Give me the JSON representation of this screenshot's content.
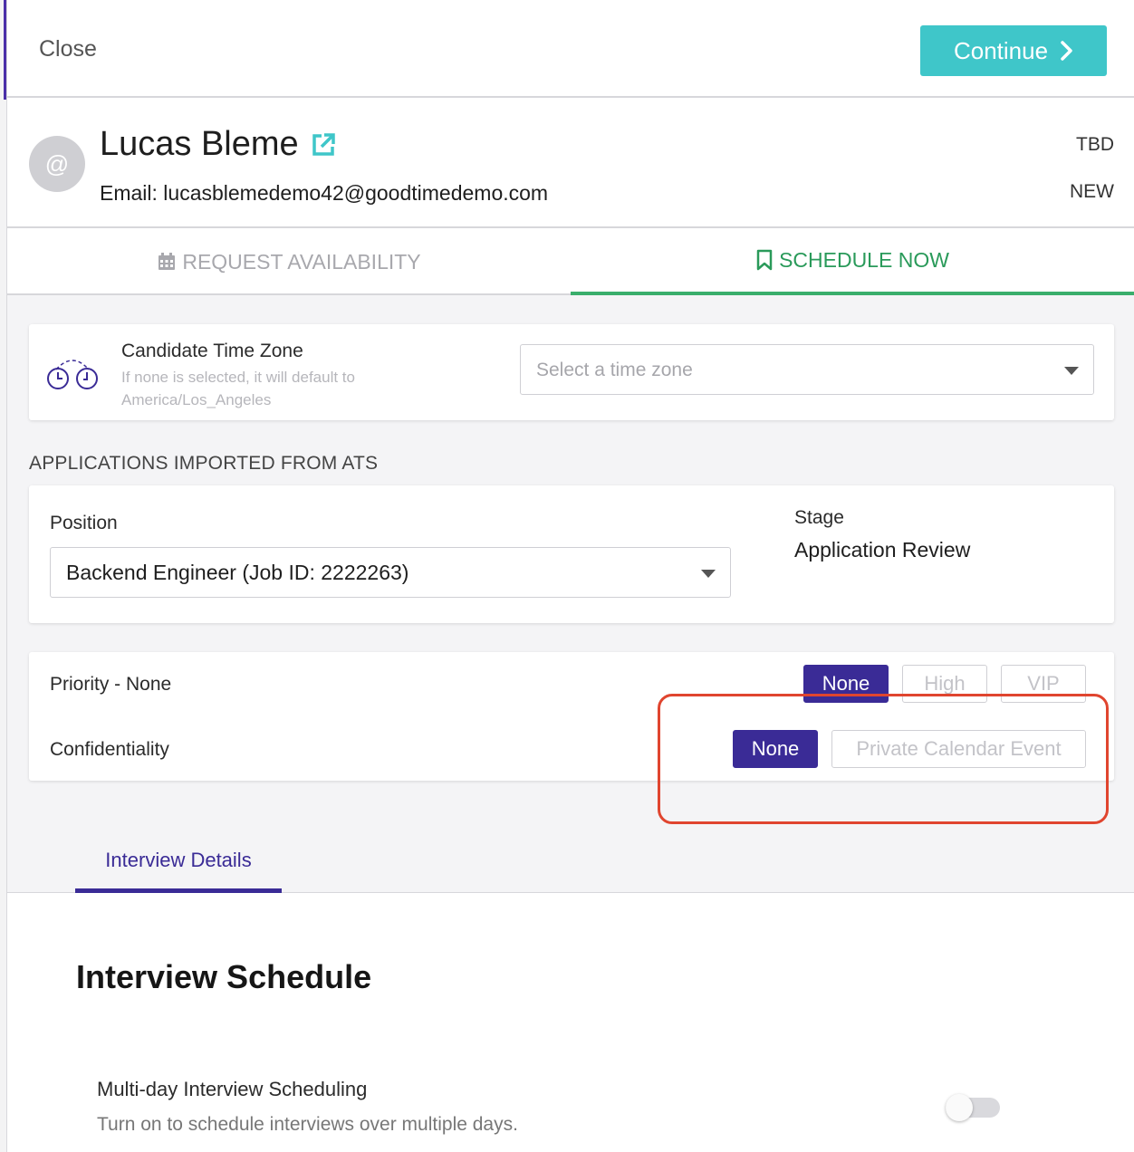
{
  "header": {
    "close_label": "Close",
    "continue_label": "Continue",
    "accent_color": "#3fc6c9"
  },
  "candidate": {
    "avatar_glyph": "@",
    "name": "Lucas Bleme",
    "email": "Email: lucasblemedemo42@goodtimedemo.com",
    "status_top": "TBD",
    "status_bottom": "NEW"
  },
  "tabs": {
    "request_label": "REQUEST AVAILABILITY",
    "schedule_label": "SCHEDULE NOW",
    "active": "schedule"
  },
  "timezone": {
    "title": "Candidate Time Zone",
    "help": "If none is selected, it will default to America/Los_Angeles",
    "placeholder": "Select a time zone"
  },
  "applications": {
    "heading": "APPLICATIONS IMPORTED FROM ATS",
    "position_label": "Position",
    "position_value": "Backend Engineer (Job ID: 2222263)",
    "stage_label": "Stage",
    "stage_value": "Application Review"
  },
  "priority": {
    "label": "Priority - None",
    "options": [
      "None",
      "High",
      "VIP"
    ],
    "selected": "None"
  },
  "confidentiality": {
    "label": "Confidentiality",
    "options": [
      "None",
      "Private Calendar Event"
    ],
    "selected": "None"
  },
  "details_tab": {
    "label": "Interview Details"
  },
  "schedule": {
    "title": "Interview Schedule",
    "multiday_title": "Multi-day Interview Scheduling",
    "multiday_desc": "Turn on to schedule interviews over multiple days.",
    "multiday_enabled": false
  },
  "colors": {
    "primary": "#3a2b96",
    "success": "#2a9a5a",
    "annotation": "#e0452f"
  }
}
